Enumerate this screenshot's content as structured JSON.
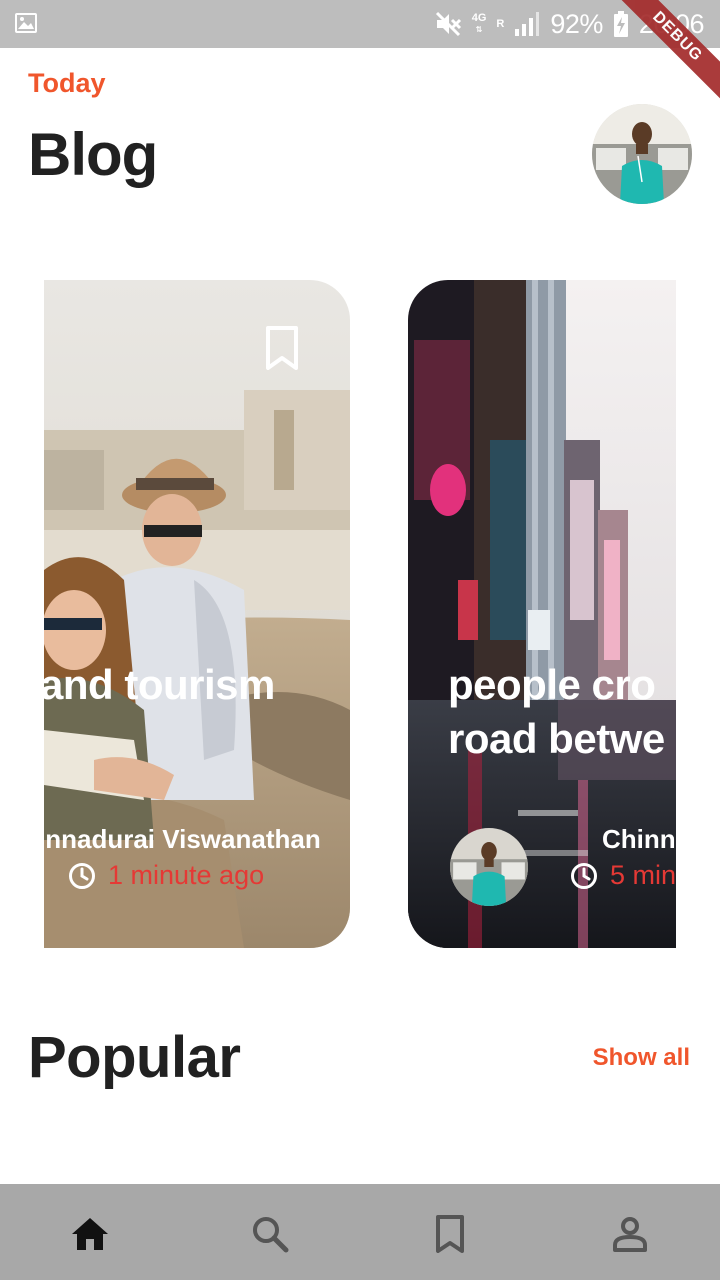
{
  "status_bar": {
    "network_top": "4G",
    "network_bottom": "R",
    "battery": "92%",
    "time": "20:06"
  },
  "debug_banner": "DEBUG",
  "header": {
    "kicker": "Today",
    "title": "Blog"
  },
  "cards": [
    {
      "title": "and tourism",
      "author": "innadurai Viswanathan",
      "time": "1 minute ago"
    },
    {
      "title_line1": "people cro",
      "title_line2": "road betwe",
      "author": "Chinna",
      "time": "5 min"
    }
  ],
  "popular": {
    "title": "Popular",
    "show_all": "Show all"
  },
  "bottom_nav": [
    "home-icon",
    "search-icon",
    "bookmark-icon",
    "profile-icon"
  ],
  "colors": {
    "accent": "#f0562c",
    "time": "#e53935",
    "status_bar": "#bdbdbd",
    "nav_bar": "#a8a8a8"
  }
}
